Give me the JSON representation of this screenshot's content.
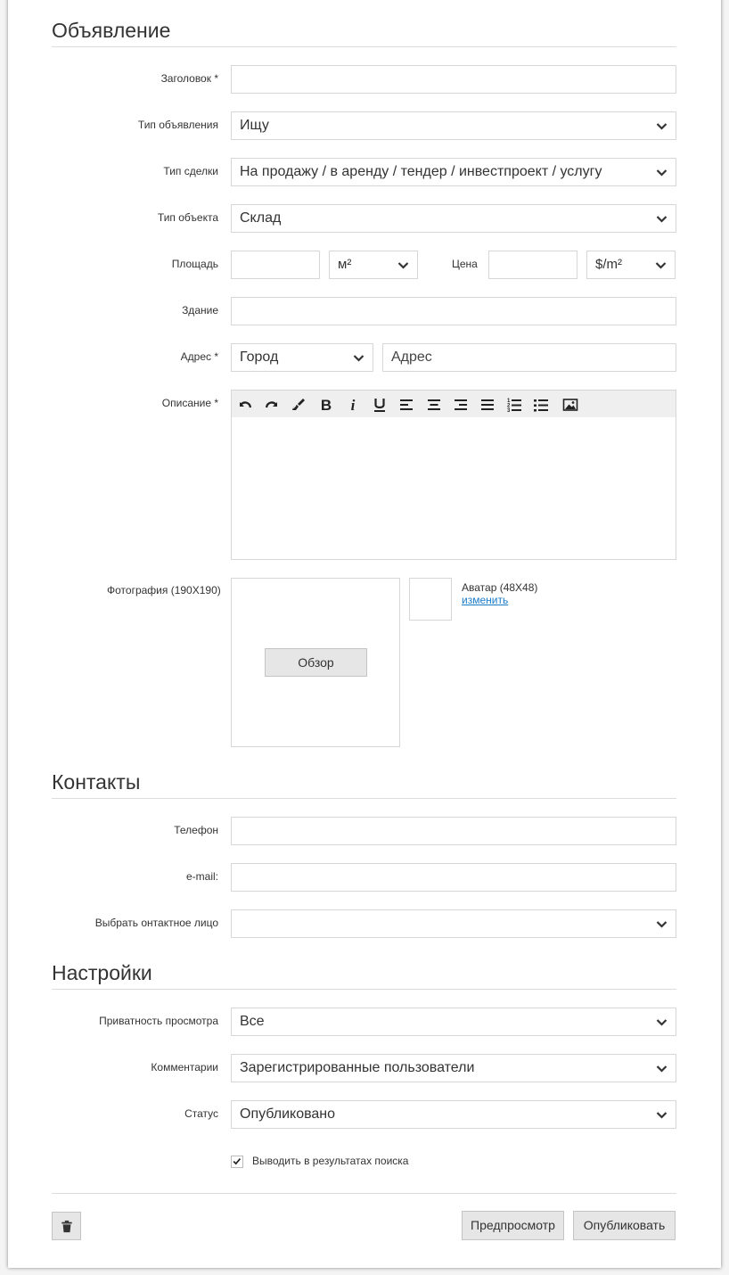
{
  "sections": {
    "ad": "Объявление",
    "contacts": "Контакты",
    "settings": "Настройки"
  },
  "ad": {
    "title_label": "Заголовок *",
    "title_value": "",
    "ad_type_label": "Тип объявления",
    "ad_type_value": "Ищу",
    "deal_type_label": "Тип сделки",
    "deal_type_value": "На продажу / в аренду / тендер / инвестпроект / услугу",
    "object_type_label": "Тип объекта",
    "object_type_value": "Склад",
    "area_label": "Площадь",
    "area_value": "",
    "area_unit": "м²",
    "price_label": "Цена",
    "price_value": "",
    "price_unit": "$/m²",
    "building_label": "Здание",
    "building_value": "",
    "address_label": "Адрес *",
    "city_value": "Город",
    "address_value": "Адрес",
    "description_label": "Описание *",
    "toolbar_icons": [
      "undo-icon",
      "redo-icon",
      "clear-format-icon",
      "bold-icon",
      "italic-icon",
      "underline-icon",
      "align-left-icon",
      "align-center-icon",
      "align-right-icon",
      "align-justify-icon",
      "ordered-list-icon",
      "unordered-list-icon",
      "image-icon"
    ],
    "photo_label": "Фотография (190X190)",
    "browse_button": "Обзор",
    "avatar_label": "Аватар (48X48)",
    "avatar_change": "изменить"
  },
  "contacts": {
    "phone_label": "Телефон",
    "phone_value": "",
    "email_label": "e-mail:",
    "email_value": "",
    "contact_person_label": "Выбрать онтактное лицо",
    "contact_person_value": ""
  },
  "settings": {
    "privacy_label": "Приватность просмотра",
    "privacy_value": "Все",
    "comments_label": "Комментарии",
    "comments_value": "Зарегистрированные пользователи",
    "status_label": "Статус",
    "status_value": "Опубликовано",
    "show_in_search_label": "Выводить в результатах поиска",
    "show_in_search_checked": true
  },
  "footer": {
    "delete_icon": "trash-icon",
    "preview_button": "Предпросмотр",
    "publish_button": "Опубликовать"
  },
  "colors": {
    "link": "#1a7bc9",
    "button_bg": "#e6e6e6",
    "toolbar_bg": "#efefef",
    "border": "#d6d6d6"
  }
}
